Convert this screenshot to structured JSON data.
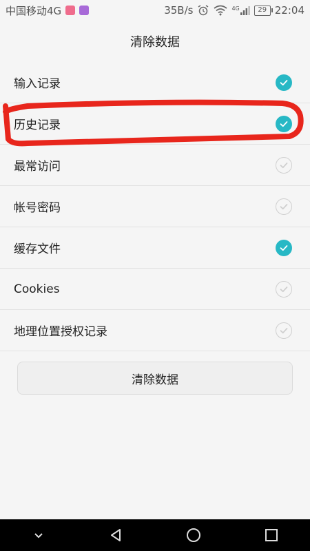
{
  "status_bar": {
    "carrier": "中国移动4G",
    "net_speed": "35B/s",
    "network_type": "4G",
    "battery": "29",
    "time": "22:04",
    "icons": [
      "app-notification-icon",
      "app-notification-icon",
      "alarm-icon",
      "wifi-icon",
      "signal-icon",
      "battery-icon"
    ]
  },
  "header": {
    "title": "清除数据"
  },
  "options": [
    {
      "label": "输入记录",
      "checked": true
    },
    {
      "label": "历史记录",
      "checked": true
    },
    {
      "label": "最常访问",
      "checked": false
    },
    {
      "label": "帐号密码",
      "checked": false
    },
    {
      "label": "缓存文件",
      "checked": true
    },
    {
      "label": "Cookies",
      "checked": false
    },
    {
      "label": "地理位置授权记录",
      "checked": false
    }
  ],
  "clear_button": {
    "label": "清除数据"
  },
  "colors": {
    "accent": "#27b8c5",
    "annotation": "#e8261c"
  },
  "nav_icons": [
    "collapse-icon",
    "back-icon",
    "home-icon",
    "recents-icon"
  ]
}
